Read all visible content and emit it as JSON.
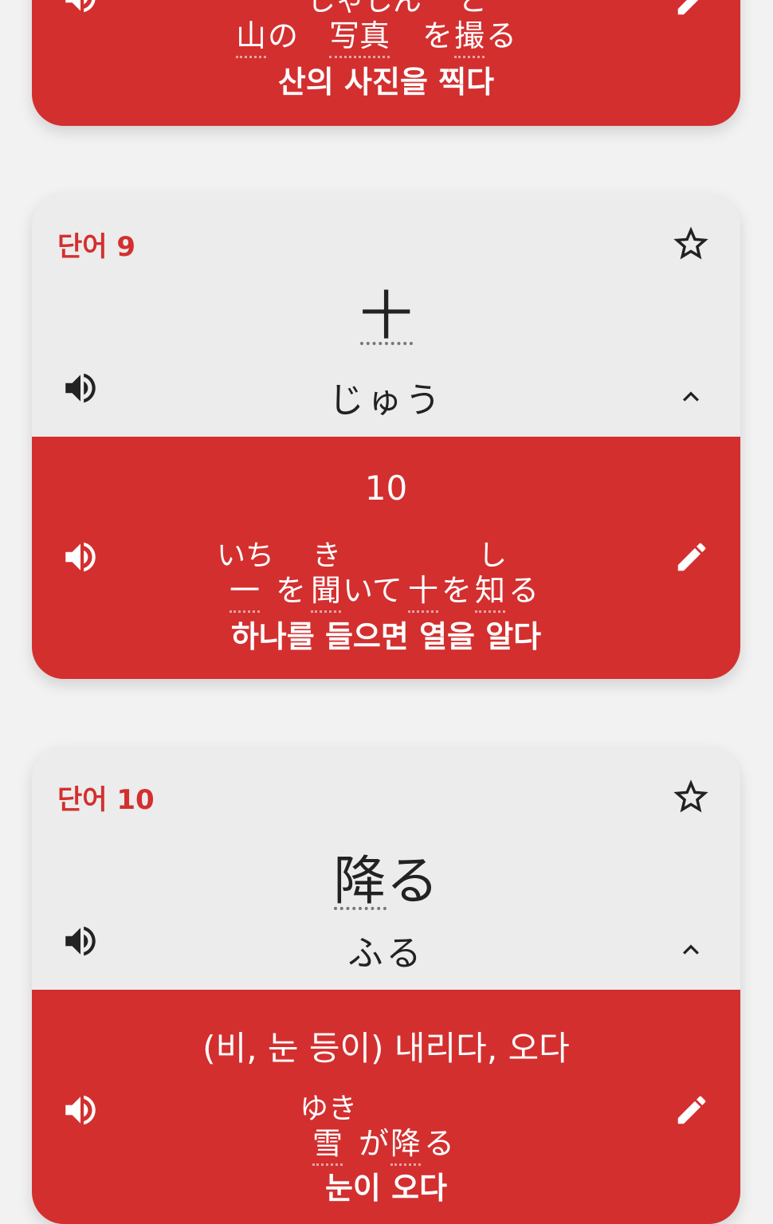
{
  "colors": {
    "accent": "#d32f2f",
    "card_bg": "#ececec",
    "page_bg": "#f2f2f2"
  },
  "card8": {
    "example_furigana": [
      "しゃしん",
      "と"
    ],
    "example_jp": [
      "山",
      "の",
      "写真",
      "を",
      "撮",
      "る"
    ],
    "example_ko": "산의 사진을 찍다"
  },
  "card9": {
    "label": "단어 9",
    "headword": "十",
    "reading": "じゅう",
    "meaning": "10",
    "example_furigana": [
      "いち",
      "き",
      "し"
    ],
    "example_jp": [
      "一",
      "を",
      "聞",
      "いて",
      "十",
      "を",
      "知",
      "る"
    ],
    "example_ko": "하나를 들으면 열을 알다"
  },
  "card10": {
    "label": "단어 10",
    "headword_kanji": "降",
    "headword_kana": "る",
    "reading": "ふる",
    "meaning": "(비, 눈 등이) 내리다, 오다",
    "example_furigana": [
      "ゆき"
    ],
    "example_jp": [
      "雪",
      "が",
      "降",
      "る"
    ],
    "example_ko": "눈이 오다"
  },
  "icons": {
    "speaker": "speaker-icon",
    "star": "star-outline-icon",
    "pencil": "pencil-icon",
    "chevron": "chevron-up-icon"
  }
}
